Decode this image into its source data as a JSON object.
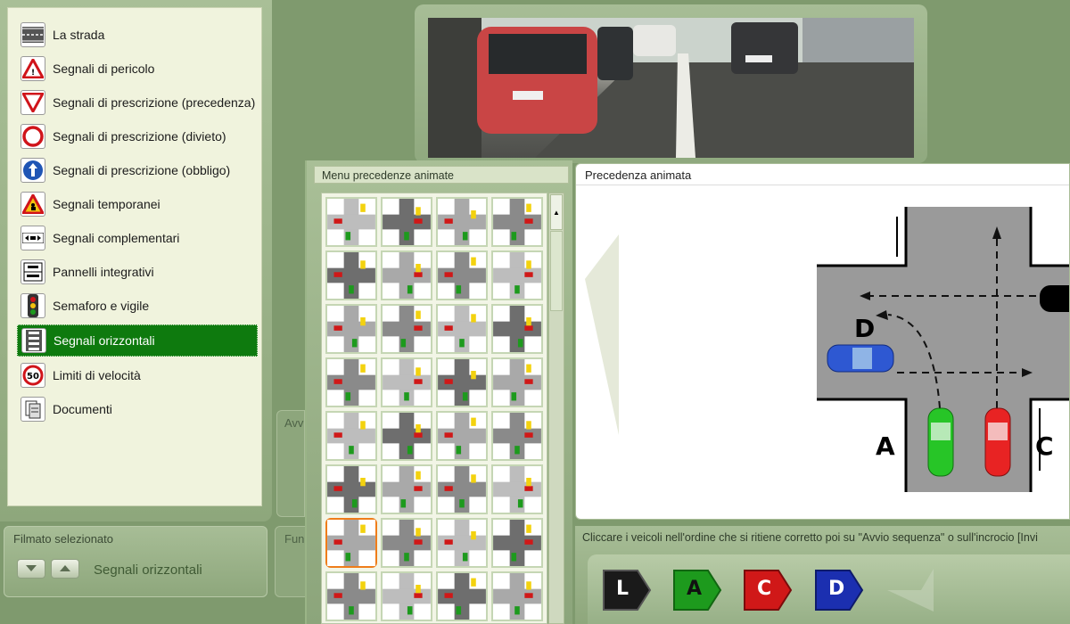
{
  "sidebar": {
    "items": [
      {
        "label": "La strada",
        "icon": "road-icon"
      },
      {
        "label": "Segnali di pericolo",
        "icon": "danger-sign-icon"
      },
      {
        "label": "Segnali di prescrizione (precedenza)",
        "icon": "yield-sign-icon"
      },
      {
        "label": "Segnali di prescrizione (divieto)",
        "icon": "prohibition-sign-icon"
      },
      {
        "label": "Segnali di prescrizione (obbligo)",
        "icon": "mandatory-sign-icon"
      },
      {
        "label": "Segnali temporanei",
        "icon": "roadworks-sign-icon"
      },
      {
        "label": "Segnali complementari",
        "icon": "complementary-sign-icon"
      },
      {
        "label": "Pannelli integrativi",
        "icon": "panel-icon"
      },
      {
        "label": "Semaforo e vigile",
        "icon": "traffic-light-icon"
      },
      {
        "label": "Segnali orizzontali",
        "icon": "road-markings-icon",
        "selected": true
      },
      {
        "label": "Limiti di velocità",
        "icon": "speed-limit-icon"
      },
      {
        "label": "Documenti",
        "icon": "documents-icon"
      }
    ],
    "speed_value": "50"
  },
  "film": {
    "title": "Filmato selezionato",
    "name": "Segnali orizzontali"
  },
  "behind_tabs": {
    "av": "Avv",
    "fun": "Fun"
  },
  "menu": {
    "title": "Menu precedenze animate"
  },
  "anim": {
    "title": "Precedenza animata",
    "labels": {
      "A": "A",
      "C": "C",
      "D": "D"
    }
  },
  "instructions": {
    "text": "Cliccare i veicoli nell'ordine che si ritiene corretto poi su \"Avvio sequenza\" o sull'incrocio [Invi"
  },
  "vehicle_buttons": [
    {
      "label": "L",
      "color": "#1a1a1a"
    },
    {
      "label": "A",
      "color": "#1d9a1d"
    },
    {
      "label": "C",
      "color": "#d01818"
    },
    {
      "label": "D",
      "color": "#1b2fb0"
    }
  ],
  "colors": {
    "selected_bg": "#0e7a0e",
    "orange_highlight": "#ef7d1a"
  }
}
